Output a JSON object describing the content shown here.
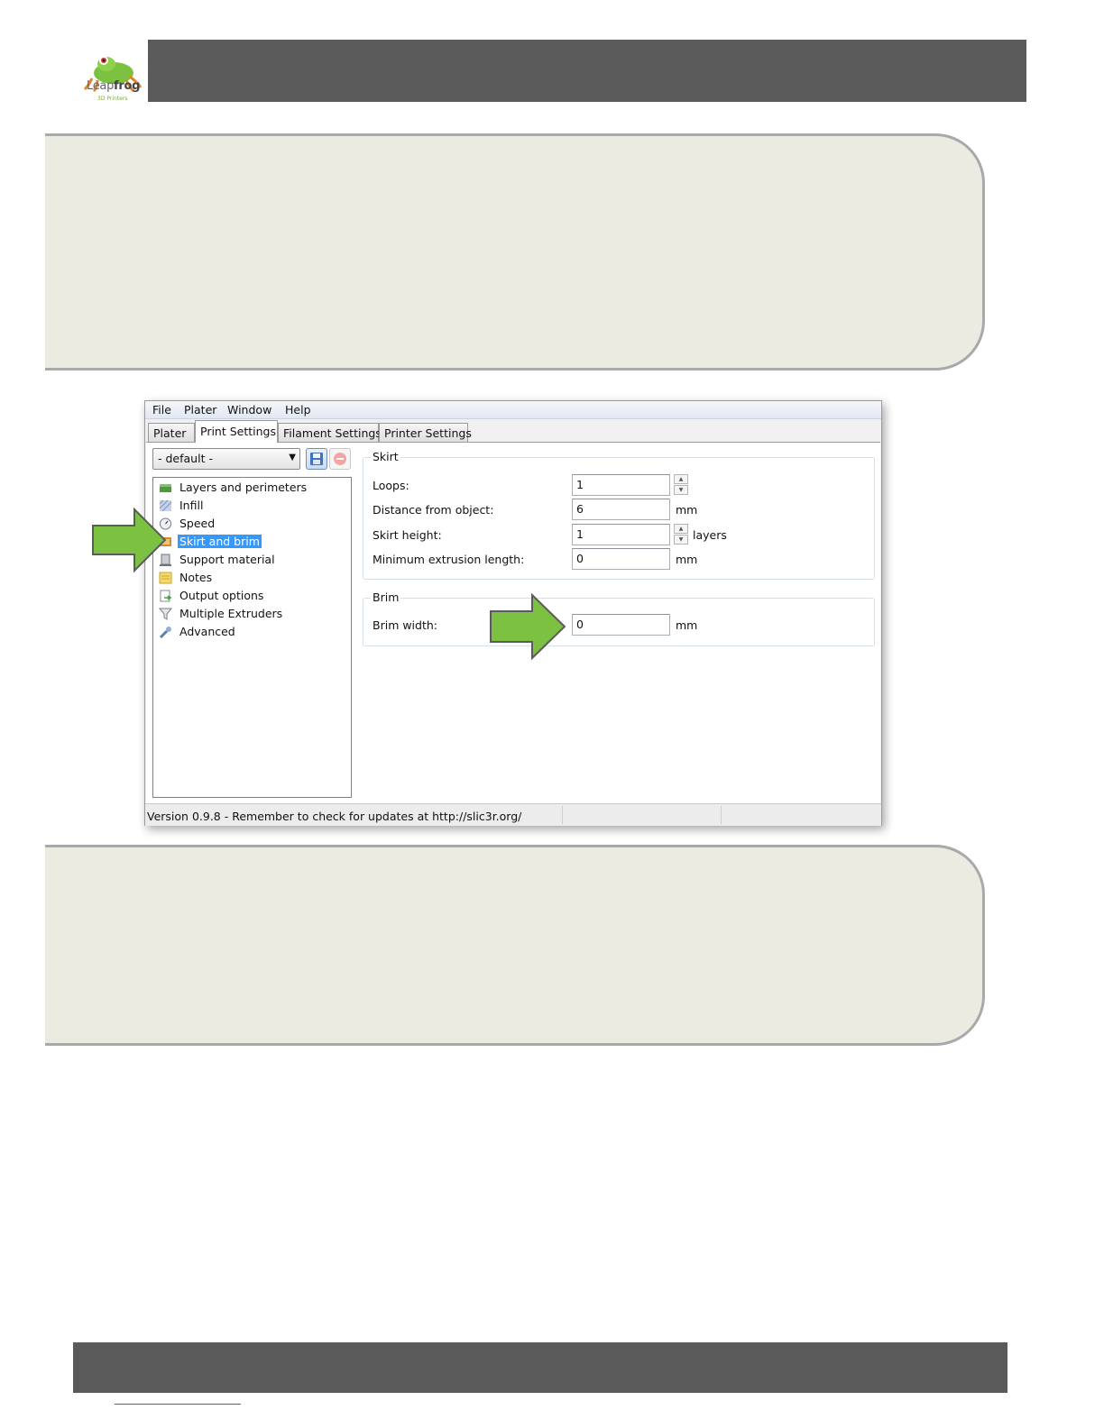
{
  "brand": {
    "logo_word_light": "Leap",
    "logo_word_bold": "frog",
    "logo_sub": "3D Printers"
  },
  "window": {
    "menu": [
      "File",
      "Plater",
      "Window",
      "Help"
    ],
    "tabs": [
      "Plater",
      "Print Settings",
      "Filament Settings",
      "Printer Settings"
    ],
    "active_tab": "Print Settings",
    "preset": "- default -",
    "tree": [
      {
        "label": "Layers and perimeters",
        "icon": "layers-icon"
      },
      {
        "label": "Infill",
        "icon": "infill-icon"
      },
      {
        "label": "Speed",
        "icon": "speed-icon"
      },
      {
        "label": "Skirt and brim",
        "icon": "skirt-brim-icon",
        "selected": true
      },
      {
        "label": "Support material",
        "icon": "support-icon"
      },
      {
        "label": "Notes",
        "icon": "notes-icon"
      },
      {
        "label": "Output options",
        "icon": "output-icon"
      },
      {
        "label": "Multiple Extruders",
        "icon": "funnel-icon"
      },
      {
        "label": "Advanced",
        "icon": "wrench-icon"
      }
    ],
    "skirt": {
      "title": "Skirt",
      "loops_label": "Loops:",
      "loops_value": "1",
      "distance_label": "Distance from object:",
      "distance_value": "6",
      "distance_unit": "mm",
      "height_label": "Skirt height:",
      "height_value": "1",
      "height_unit": "layers",
      "min_extrusion_label": "Minimum extrusion length:",
      "min_extrusion_value": "0",
      "min_extrusion_unit": "mm"
    },
    "brim": {
      "title": "Brim",
      "width_label": "Brim width:",
      "width_value": "0",
      "width_unit": "mm"
    },
    "status": "Version 0.9.8 - Remember to check for updates at http://slic3r.org/"
  },
  "colors": {
    "header_bar": "#5a5a5a",
    "callout_bg": "#ecebe2",
    "callout_border": "#a9a9a9",
    "arrow_green": "#7dc142",
    "selection_blue": "#3399ff"
  }
}
